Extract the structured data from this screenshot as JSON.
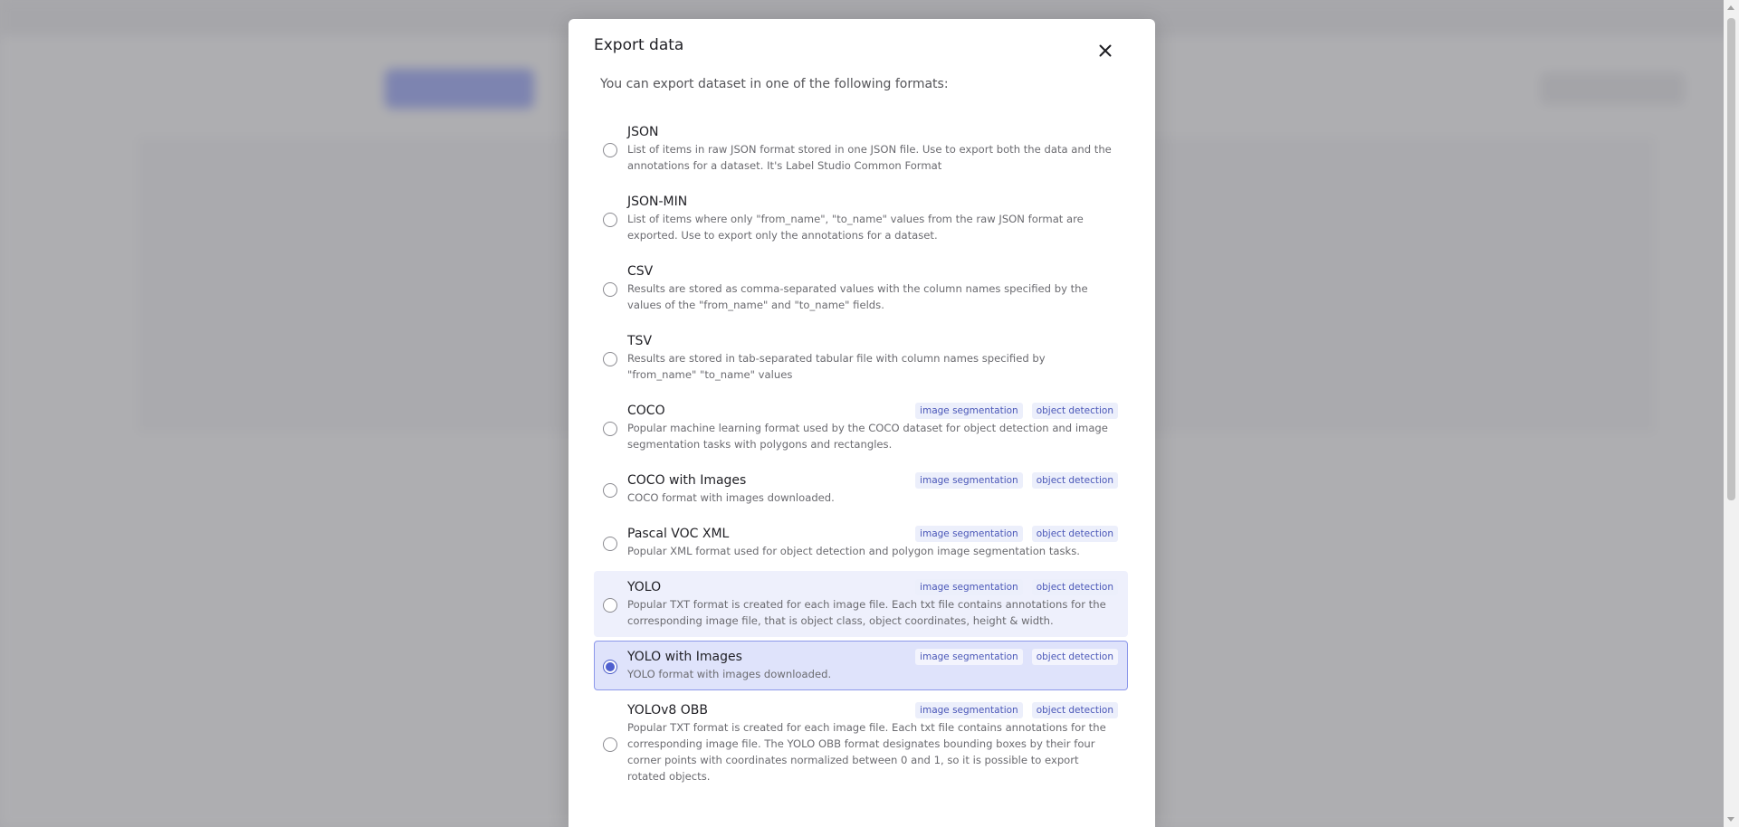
{
  "modal": {
    "title": "Export data",
    "intro": "You can export dataset in one of the following formats:",
    "close_icon": "close-icon"
  },
  "formats": [
    {
      "title": "JSON",
      "description": "List of items in raw JSON format stored in one JSON file. Use to export both the data and the annotations for a dataset. It's Label Studio Common Format",
      "tags": [],
      "state": "default"
    },
    {
      "title": "JSON-MIN",
      "description": "List of items where only \"from_name\", \"to_name\" values from the raw JSON format are exported. Use to export only the annotations for a dataset.",
      "tags": [],
      "state": "default"
    },
    {
      "title": "CSV",
      "description": "Results are stored as comma-separated values with the column names specified by the values of the \"from_name\" and \"to_name\" fields.",
      "tags": [],
      "state": "default"
    },
    {
      "title": "TSV",
      "description": "Results are stored in tab-separated tabular file with column names specified by \"from_name\" \"to_name\" values",
      "tags": [],
      "state": "default"
    },
    {
      "title": "COCO",
      "description": "Popular machine learning format used by the COCO dataset for object detection and image segmentation tasks with polygons and rectangles.",
      "tags": [
        "image segmentation",
        "object detection"
      ],
      "state": "default"
    },
    {
      "title": "COCO with Images",
      "description": "COCO format with images downloaded.",
      "tags": [
        "image segmentation",
        "object detection"
      ],
      "state": "default"
    },
    {
      "title": "Pascal VOC XML",
      "description": "Popular XML format used for object detection and polygon image segmentation tasks.",
      "tags": [
        "image segmentation",
        "object detection"
      ],
      "state": "default"
    },
    {
      "title": "YOLO",
      "description": "Popular TXT format is created for each image file. Each txt file contains annotations for the corresponding image file, that is object class, object coordinates, height & width.",
      "tags": [
        "image segmentation",
        "object detection"
      ],
      "state": "hover"
    },
    {
      "title": "YOLO with Images",
      "description": "YOLO format with images downloaded.",
      "tags": [
        "image segmentation",
        "object detection"
      ],
      "state": "selected"
    },
    {
      "title": "YOLOv8 OBB",
      "description": "Popular TXT format is created for each image file. Each txt file contains annotations for the corresponding image file. The YOLO OBB format designates bounding boxes by their four corner points with coordinates normalized between 0 and 1, so it is possible to export rotated objects.",
      "tags": [
        "image segmentation",
        "object detection"
      ],
      "state": "default"
    }
  ],
  "colors": {
    "accent": "#4f5fcf",
    "selected_bg": "#dfe3fb",
    "hover_bg": "#eef0fc",
    "tag_text": "#4a57b8"
  }
}
